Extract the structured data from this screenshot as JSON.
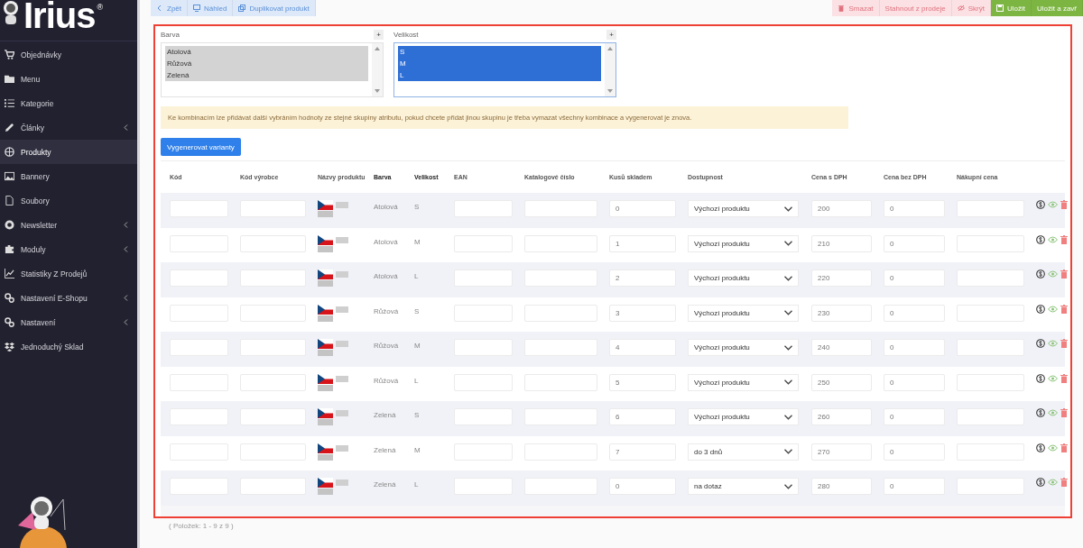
{
  "logo": {
    "text": "Irius",
    "mark": "®"
  },
  "sidebar": {
    "items": [
      {
        "label": "Objednávky",
        "selected": false,
        "has_submenu": false
      },
      {
        "label": "Menu",
        "selected": false,
        "has_submenu": false
      },
      {
        "label": "Kategorie",
        "selected": false,
        "has_submenu": false
      },
      {
        "label": "Články",
        "selected": false,
        "has_submenu": true
      },
      {
        "label": "Produkty",
        "selected": true,
        "has_submenu": false
      },
      {
        "label": "Bannery",
        "selected": false,
        "has_submenu": false
      },
      {
        "label": "Soubory",
        "selected": false,
        "has_submenu": false
      },
      {
        "label": "Newsletter",
        "selected": false,
        "has_submenu": true
      },
      {
        "label": "Moduly",
        "selected": false,
        "has_submenu": true
      },
      {
        "label": "Statistiky Z Prodejů",
        "selected": false,
        "has_submenu": false
      },
      {
        "label": "Nastavení E-Shopu",
        "selected": false,
        "has_submenu": true
      },
      {
        "label": "Nastavení",
        "selected": false,
        "has_submenu": true
      },
      {
        "label": "Jednoduchý Sklad",
        "selected": false,
        "has_submenu": false
      }
    ]
  },
  "toolbar": {
    "left": [
      {
        "label": "Zpět",
        "kind": "back"
      },
      {
        "label": "Náhled",
        "kind": "preview"
      },
      {
        "label": "Duplikovat produkt",
        "kind": "duplicate"
      }
    ],
    "right": [
      {
        "label": "Smazat",
        "kind": "delete"
      },
      {
        "label": "Stahnout z prodeje",
        "kind": "withdraw"
      },
      {
        "label": "Skrýt",
        "kind": "hide"
      },
      {
        "label": "Uložit",
        "kind": "save"
      },
      {
        "label": "Uložit a zavř",
        "kind": "save-close"
      }
    ]
  },
  "attributes": [
    {
      "label": "Barva",
      "add": "+",
      "focused": false,
      "options": [
        {
          "label": "Atolová",
          "selected": true
        },
        {
          "label": "Růžová",
          "selected": true
        },
        {
          "label": "Zelená",
          "selected": true
        }
      ]
    },
    {
      "label": "Velikost",
      "add": "+",
      "focused": true,
      "options": [
        {
          "label": "S",
          "selected": true
        },
        {
          "label": "M",
          "selected": true
        },
        {
          "label": "L",
          "selected": true
        }
      ]
    }
  ],
  "alert": "Ke kombinacím lze přidávat další vybráním hodnoty ze stejné skupiny atributu, pokud chcete přidat jinou skupinu je třeba vymazat všechny kombinace a vygenerovat je znova.",
  "generate_button": "Vygenerovat varianty",
  "table": {
    "columns": [
      "Kód",
      "Kód výrobce",
      "Názvy produktu",
      "Barva",
      "Velikost",
      "EAN",
      "Katalogové číslo",
      "Kusů skladem",
      "Dostupnost",
      "Cena s DPH",
      "Cena bez DPH",
      "Nákupní cena"
    ],
    "rows": [
      {
        "barva": "Atolová",
        "velikost": "S",
        "stock": "0",
        "availability": "Výchozí produktu",
        "price_vat": "200",
        "price_net": "0"
      },
      {
        "barva": "Atolová",
        "velikost": "M",
        "stock": "1",
        "availability": "Výchozí produktu",
        "price_vat": "210",
        "price_net": "0"
      },
      {
        "barva": "Atolová",
        "velikost": "L",
        "stock": "2",
        "availability": "Výchozí produktu",
        "price_vat": "220",
        "price_net": "0"
      },
      {
        "barva": "Růžová",
        "velikost": "S",
        "stock": "3",
        "availability": "Výchozí produktu",
        "price_vat": "230",
        "price_net": "0"
      },
      {
        "barva": "Růžová",
        "velikost": "M",
        "stock": "4",
        "availability": "Výchozí produktu",
        "price_vat": "240",
        "price_net": "0"
      },
      {
        "barva": "Růžová",
        "velikost": "L",
        "stock": "5",
        "availability": "Výchozí produktu",
        "price_vat": "250",
        "price_net": "0"
      },
      {
        "barva": "Zelená",
        "velikost": "S",
        "stock": "6",
        "availability": "Výchozí produktu",
        "price_vat": "260",
        "price_net": "0"
      },
      {
        "barva": "Zelená",
        "velikost": "M",
        "stock": "7",
        "availability": "do 3 dnů",
        "price_vat": "270",
        "price_net": "0"
      },
      {
        "barva": "Zelená",
        "velikost": "L",
        "stock": "0",
        "availability": "na dotaz",
        "price_vat": "280",
        "price_net": "0"
      }
    ]
  },
  "footer": "( Položek: 1 - 9 z 9 )"
}
